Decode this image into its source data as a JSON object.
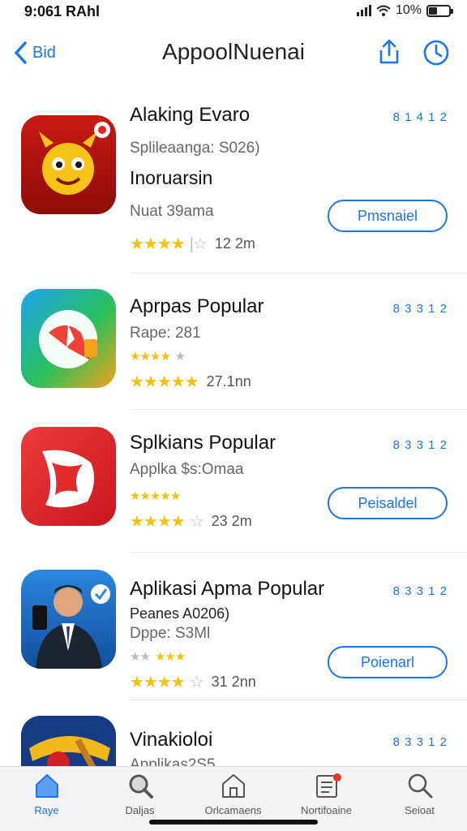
{
  "status": {
    "time": "9:061 RAhl",
    "battery": "10%"
  },
  "nav": {
    "back_label": "Bid",
    "title": "AppoolNuenai"
  },
  "apps": [
    {
      "title": "Alaking Evaro",
      "line1": "Splileaanga: S026)",
      "line2": "Inoruarsin",
      "line3": "Nuat 39ama",
      "rating_count": "12 2m",
      "meta": "8 1 4 1 2",
      "button": "Pmsnaiel"
    },
    {
      "title": "Aprpas Popular",
      "line1": "Rape: 281",
      "rating_count": "27.1nn",
      "meta": "8 3 3 1 2"
    },
    {
      "title": "Splkians Popular",
      "line1": "Applka $s:Omaa",
      "rating_count": "23 2m",
      "meta": "8 3 3 1 2",
      "button": "Peisaldel"
    },
    {
      "title": "Aplikasi Apma Popular",
      "line1": "Peanes A0206)",
      "line2": "Dppe: S3Ml",
      "rating_count": "31 2nn",
      "meta": "8 3 3 1 2",
      "button": "Poienarl"
    },
    {
      "title": "Vinakioloi",
      "line1": "Applikas2S5",
      "meta": "8 3 3 1 2"
    }
  ],
  "tabs": [
    {
      "label": "Raye",
      "icon": "home-icon",
      "active": true
    },
    {
      "label": "Daljas",
      "icon": "magnifier-icon",
      "active": false
    },
    {
      "label": "Orlcamaens",
      "icon": "house-outline-icon",
      "active": false
    },
    {
      "label": "Nortifoaine",
      "icon": "notification-list-icon",
      "active": false
    },
    {
      "label": "Seioat",
      "icon": "search-icon",
      "active": false
    }
  ],
  "colors": {
    "accent": "#1b74e8",
    "star": "#f3c20a"
  }
}
